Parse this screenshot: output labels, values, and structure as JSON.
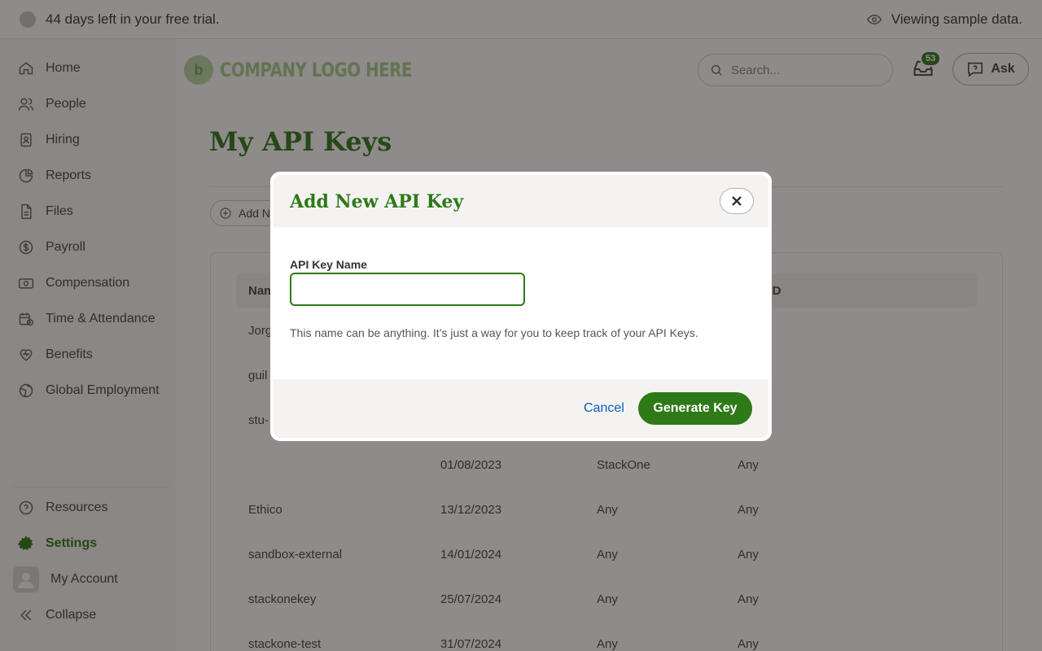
{
  "trial_bar": {
    "trial_text": "44 days left in your free trial.",
    "sample_text": "Viewing sample data."
  },
  "sidebar": {
    "items": [
      {
        "label": "Home",
        "icon": "home-icon"
      },
      {
        "label": "People",
        "icon": "people-icon"
      },
      {
        "label": "Hiring",
        "icon": "hiring-icon"
      },
      {
        "label": "Reports",
        "icon": "reports-icon"
      },
      {
        "label": "Files",
        "icon": "files-icon"
      },
      {
        "label": "Payroll",
        "icon": "payroll-icon"
      },
      {
        "label": "Compensation",
        "icon": "compensation-icon"
      },
      {
        "label": "Time & Attendance",
        "icon": "time-attendance-icon"
      },
      {
        "label": "Benefits",
        "icon": "benefits-icon"
      },
      {
        "label": "Global Employment",
        "icon": "globe-icon"
      }
    ],
    "bottom_items": [
      {
        "label": "Resources",
        "icon": "help-icon"
      },
      {
        "label": "Settings",
        "icon": "gear-icon",
        "active": true
      },
      {
        "label": "My Account",
        "icon": "avatar-icon"
      },
      {
        "label": "Collapse",
        "icon": "double-chevron-left-icon"
      }
    ]
  },
  "header": {
    "logo_text": "COMPANY LOGO HERE",
    "logo_mark": "b",
    "search_placeholder": "Search...",
    "inbox_count": "53",
    "ask_label": "Ask"
  },
  "page": {
    "title": "My API Keys",
    "add_button_partial": "Add N",
    "columns": {
      "name_partial": "Nam",
      "id_partial": "e ID"
    },
    "rows": [
      {
        "name": "Jorg",
        "created": "",
        "app": "",
        "id": ""
      },
      {
        "name": "guil",
        "created": "",
        "app": "",
        "id": ""
      },
      {
        "name": "stu-",
        "created": "",
        "app": "",
        "id": ""
      },
      {
        "name": "",
        "created": "01/08/2023",
        "app": "StackOne",
        "id": "Any"
      },
      {
        "name": "Ethico",
        "created": "13/12/2023",
        "app": "Any",
        "id": "Any"
      },
      {
        "name": "sandbox-external",
        "created": "14/01/2024",
        "app": "Any",
        "id": "Any"
      },
      {
        "name": "stackonekey",
        "created": "25/07/2024",
        "app": "Any",
        "id": "Any"
      },
      {
        "name": "stackone-test",
        "created": "31/07/2024",
        "app": "Any",
        "id": "Any"
      }
    ]
  },
  "modal": {
    "title": "Add New API Key",
    "field_label": "API Key Name",
    "field_value": "",
    "help_text": "This name can be anything. It’s just a way for you to keep track of your API Keys.",
    "cancel_label": "Cancel",
    "generate_label": "Generate Key"
  },
  "colors": {
    "brand_green": "#2e7918",
    "link_blue": "#0b5cbd",
    "overlay": "rgba(30,24,22,0.5)"
  }
}
